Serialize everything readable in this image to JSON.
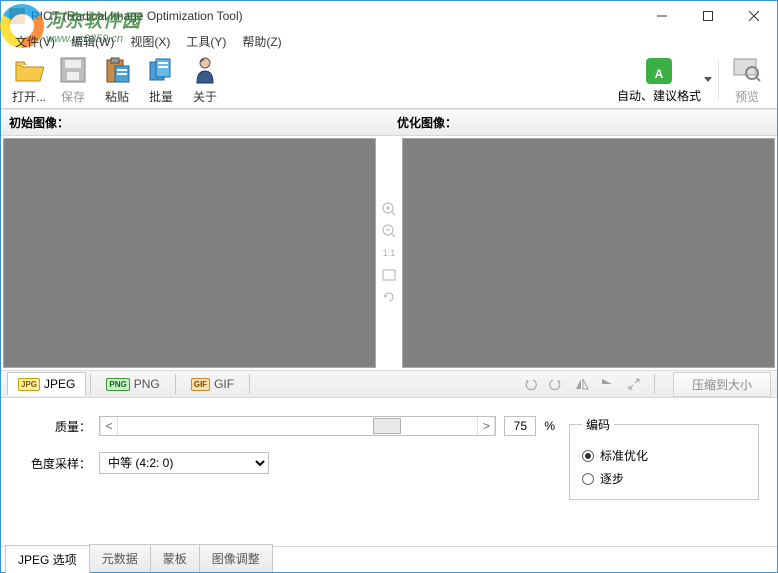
{
  "window": {
    "title": "RIOT (Radical Image Optimization Tool)"
  },
  "menu": {
    "file": "文件(V)",
    "edit": "编辑(W)",
    "view": "视图(X)",
    "tools": "工具(Y)",
    "help": "帮助(Z)"
  },
  "watermark": {
    "name": "河东软件园",
    "url": "www.pc0359.cn"
  },
  "toolbar": {
    "open": "打开...",
    "save": "保存",
    "paste": "粘贴",
    "batch": "批量",
    "about": "关于",
    "auto_suggest": "自动、建议格式",
    "preview": "预览"
  },
  "panes": {
    "original": "初始图像：",
    "optimized": "优化图像："
  },
  "midtools": {
    "zoom_in": "zoom-in-icon",
    "zoom_out": "zoom-out-icon",
    "one_to_one": "1:1",
    "fit": "fit-icon",
    "refresh": "refresh-icon"
  },
  "format_tabs": {
    "jpeg": "JPEG",
    "png": "PNG",
    "gif": "GIF",
    "compress_to_size": "压缩到大小"
  },
  "options": {
    "quality_label": "质量：",
    "quality_value": "75",
    "quality_percent": "%",
    "chroma_label": "色度采样：",
    "chroma_value": "中等 (4:2: 0)",
    "encoding_legend": "编码",
    "enc_standard": "标准优化",
    "enc_progressive": "逐步"
  },
  "bottom_tabs": {
    "jpeg_options": "JPEG 选项",
    "metadata": "元数据",
    "mask": "蒙板",
    "image_adjust": "图像调整"
  }
}
